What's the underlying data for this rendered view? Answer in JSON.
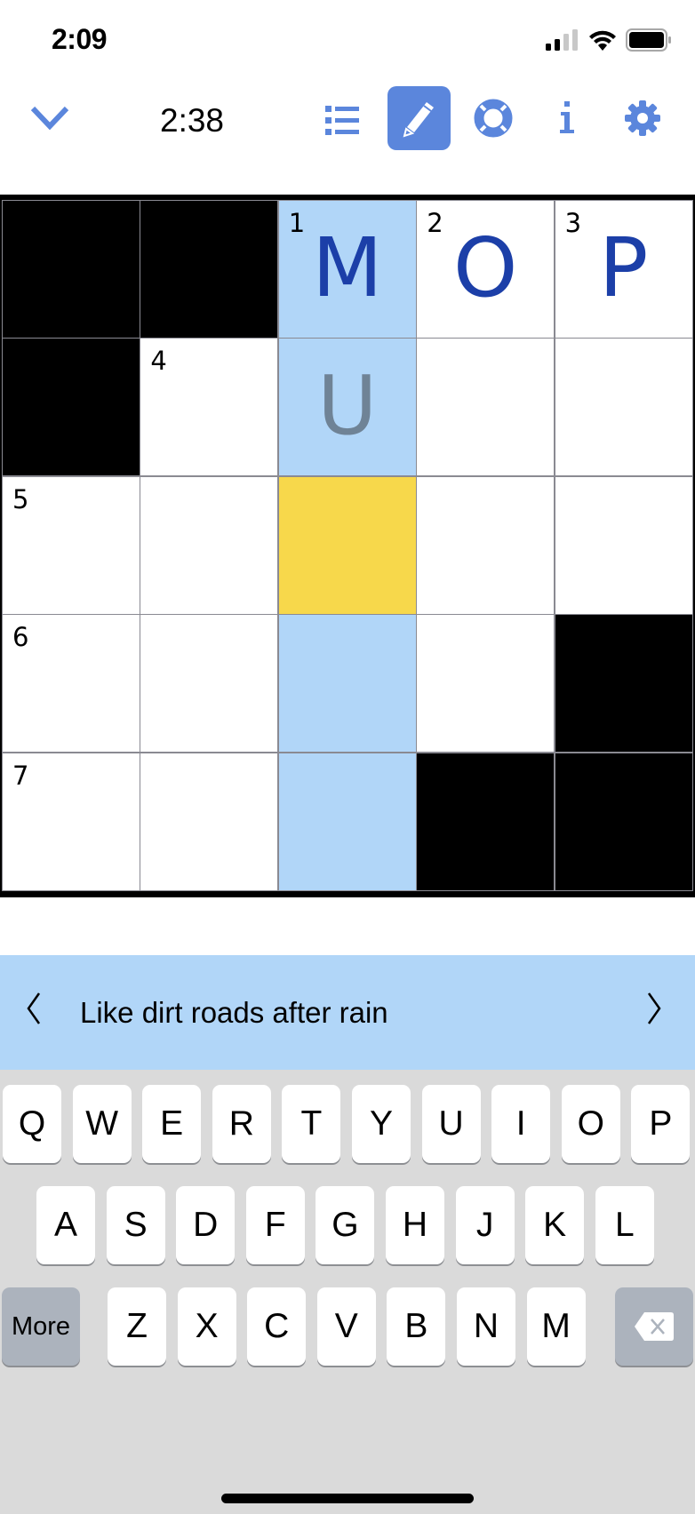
{
  "status_bar": {
    "time": "2:09",
    "signal": "signal-icon",
    "wifi": "wifi-icon",
    "battery": "battery-icon"
  },
  "toolbar": {
    "collapse": "chevron-down-icon",
    "timer": "2:38",
    "buttons": [
      "list-icon",
      "pencil-icon",
      "lifebuoy-icon",
      "info-icon",
      "gear-icon"
    ],
    "accent": "#5b86dc"
  },
  "puzzle": {
    "size": 5,
    "colors": {
      "block": "#000000",
      "empty": "#ffffff",
      "highlight": "#b1d6f8",
      "selected": "#f7d84b",
      "letter": "#1c3fa8",
      "pencil_letter": "#6f8396"
    },
    "cells": [
      [
        {
          "block": true
        },
        {
          "block": true
        },
        {
          "num": "1",
          "letter": "M",
          "state": "highlight"
        },
        {
          "num": "2",
          "letter": "O"
        },
        {
          "num": "3",
          "letter": "P"
        }
      ],
      [
        {
          "block": true
        },
        {
          "num": "4"
        },
        {
          "letter": "U",
          "state": "highlight",
          "pencil": true
        },
        {},
        {}
      ],
      [
        {
          "num": "5"
        },
        {},
        {
          "state": "selected"
        },
        {},
        {}
      ],
      [
        {
          "num": "6"
        },
        {},
        {
          "state": "highlight"
        },
        {},
        {
          "block": true
        }
      ],
      [
        {
          "num": "7"
        },
        {},
        {
          "state": "highlight"
        },
        {
          "block": true
        },
        {
          "block": true
        }
      ]
    ]
  },
  "clue": {
    "text": "Like dirt roads after rain",
    "prev": "chevron-left-icon",
    "next": "chevron-right-icon"
  },
  "keyboard": {
    "row1": [
      "Q",
      "W",
      "E",
      "R",
      "T",
      "Y",
      "U",
      "I",
      "O",
      "P"
    ],
    "row2": [
      "A",
      "S",
      "D",
      "F",
      "G",
      "H",
      "J",
      "K",
      "L"
    ],
    "row3": [
      "Z",
      "X",
      "C",
      "V",
      "B",
      "N",
      "M"
    ],
    "more_label": "More",
    "backspace": "backspace-icon"
  }
}
